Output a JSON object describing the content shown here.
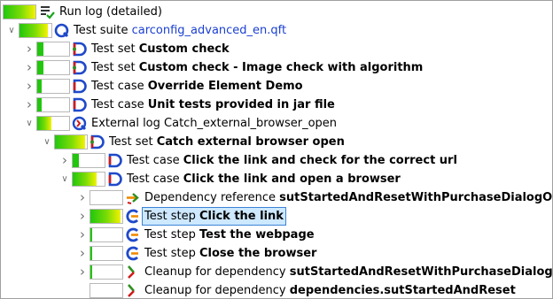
{
  "tree": {
    "root": {
      "label": "Run log (detailed)",
      "icon": "run-log-icon",
      "progress": 1.0,
      "bar_color": "green-yellow"
    },
    "rows": [
      {
        "type": "suite",
        "prefix": "Test suite ",
        "name": "carconfig_advanced_en.qft",
        "icon": "test-suite-icon",
        "expanded": true,
        "progress": 0.9
      },
      {
        "type": "set",
        "prefix": "Test set ",
        "name": "Custom check",
        "icon": "test-set-icon",
        "expanded": false,
        "progress": 0.2
      },
      {
        "type": "set",
        "prefix": "Test set ",
        "name": "Custom check - Image check with algorithm",
        "icon": "test-set-icon",
        "expanded": false,
        "progress": 0.2
      },
      {
        "type": "case",
        "prefix": "Test case ",
        "name": "Override Element Demo",
        "icon": "test-case-icon",
        "expanded": false,
        "progress": 0.15
      },
      {
        "type": "case",
        "prefix": "Test case ",
        "name": "Unit tests provided in jar file",
        "icon": "test-case-icon",
        "expanded": false,
        "progress": 0.15
      },
      {
        "type": "extlog",
        "prefix": "External log ",
        "name": "Catch_external_browser_open",
        "icon": "external-log-icon",
        "expanded": true,
        "progress": 0.45
      },
      {
        "type": "set",
        "prefix": "Test set ",
        "name": "Catch external browser open",
        "icon": "test-set-icon",
        "expanded": true,
        "progress": 0.95
      },
      {
        "type": "case",
        "prefix": "Test case ",
        "name": "Click the link and check for the correct url",
        "icon": "test-case-icon",
        "expanded": false,
        "progress": 0.2
      },
      {
        "type": "case",
        "prefix": "Test case ",
        "name": "Click the link and open a browser",
        "icon": "test-case-icon",
        "expanded": true,
        "progress": 0.75
      },
      {
        "type": "depref",
        "prefix": "Dependency reference ",
        "name": "sutStartedAndResetWithPurchaseDialogOpen",
        "icon": "dependency-reference-icon",
        "expanded": false,
        "progress": 0.0
      },
      {
        "type": "step",
        "prefix": "Test step ",
        "name": "Click the link",
        "icon": "test-step-icon",
        "expanded": false,
        "progress": 0.95,
        "selected": true
      },
      {
        "type": "step",
        "prefix": "Test step ",
        "name": "Test the webpage",
        "icon": "test-step-icon",
        "expanded": false,
        "progress": 0.05
      },
      {
        "type": "step",
        "prefix": "Test step ",
        "name": "Close the browser",
        "icon": "test-step-icon",
        "expanded": false,
        "progress": 0.05
      },
      {
        "type": "cleanup",
        "prefix": "Cleanup for dependency ",
        "name": "sutStartedAndResetWithPurchaseDialogOpen",
        "icon": "cleanup-icon",
        "expanded": false,
        "progress": 0.05
      },
      {
        "type": "cleanup",
        "prefix": "Cleanup for dependency ",
        "name": "dependencies.sutStartedAndReset",
        "icon": "cleanup-icon",
        "expanded": null,
        "progress": 0.0
      }
    ]
  },
  "colors": {
    "green": "#22c60e",
    "yellow": "#f2f200",
    "suite_blue": "#1f49c9",
    "step_blue": "#1f49c9",
    "step_orange": "#f08a00",
    "red": "#d11a1a",
    "dark_green": "#2f8f1f",
    "selection": "#cde8ff"
  }
}
